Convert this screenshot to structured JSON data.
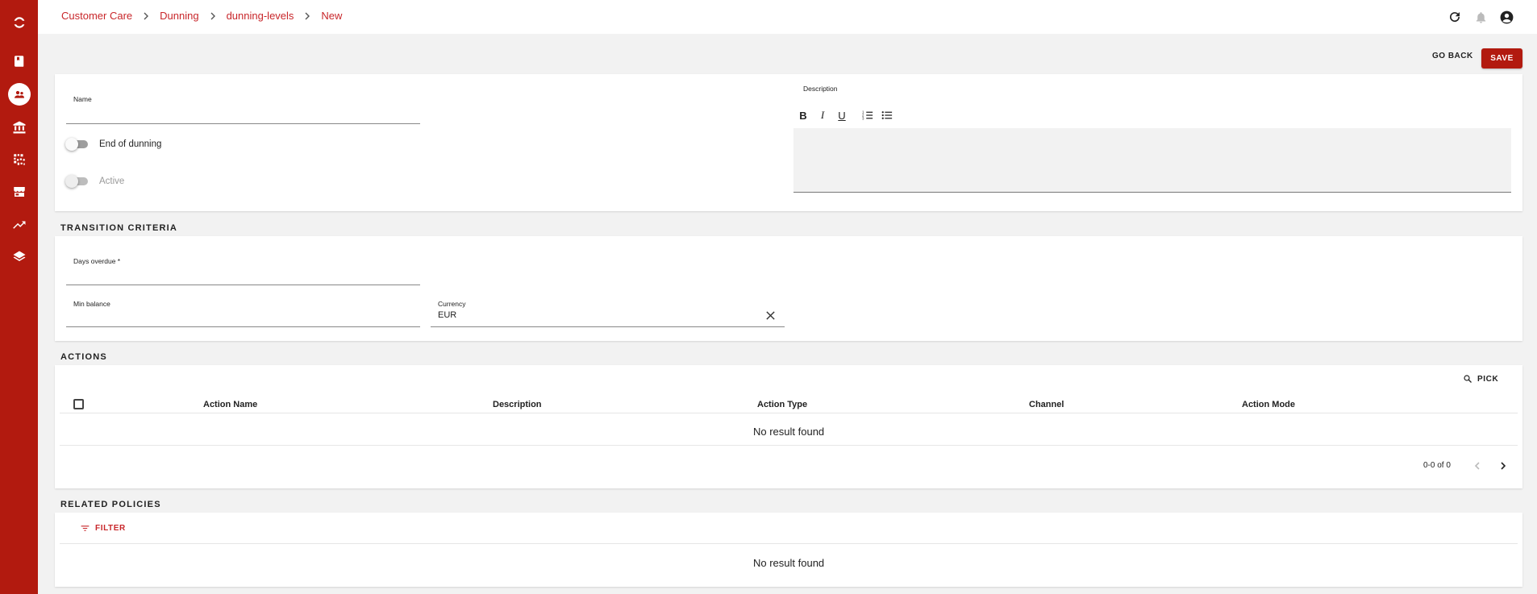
{
  "breadcrumb": [
    "Customer Care",
    "Dunning",
    "dunning-levels",
    "New"
  ],
  "colors": {
    "brand": "#b21a0f",
    "link": "#c8262a",
    "background": "#f2f2f2"
  },
  "sidebar": {
    "items": [
      {
        "icon": "app-logo-icon"
      },
      {
        "icon": "book-icon"
      },
      {
        "icon": "customers-icon",
        "active": true
      },
      {
        "icon": "bank-icon"
      },
      {
        "icon": "qr-code-icon"
      },
      {
        "icon": "store-icon"
      },
      {
        "icon": "trending-up-icon"
      },
      {
        "icon": "layers-icon"
      }
    ]
  },
  "topbar": {
    "icons": [
      "refresh-icon",
      "bell-icon",
      "account-icon"
    ]
  },
  "actions": {
    "go_back": "GO BACK",
    "save": "SAVE"
  },
  "general": {
    "name_label": "Name",
    "name_value": "",
    "end_of_dunning_label": "End of dunning",
    "end_of_dunning": false,
    "active_label": "Active",
    "active": false,
    "description_label": "Description",
    "toolbar": [
      "B",
      "I",
      "U",
      "ordered-list",
      "bullet-list"
    ]
  },
  "transition": {
    "title": "TRANSITION CRITERIA",
    "days_overdue_label": "Days overdue *",
    "days_overdue_value": "",
    "min_balance_label": "Min balance",
    "min_balance_value": "",
    "currency_label": "Currency",
    "currency_value": "EUR"
  },
  "actions_section": {
    "title": "ACTIONS",
    "pick": "PICK",
    "columns": [
      "Action Name",
      "Description",
      "Action Type",
      "Channel",
      "Action Mode"
    ],
    "rows": [],
    "empty": "No result found",
    "pagination": "0-0 of 0"
  },
  "policies": {
    "title": "RELATED POLICIES",
    "filter": "FILTER",
    "empty": "No result found"
  }
}
